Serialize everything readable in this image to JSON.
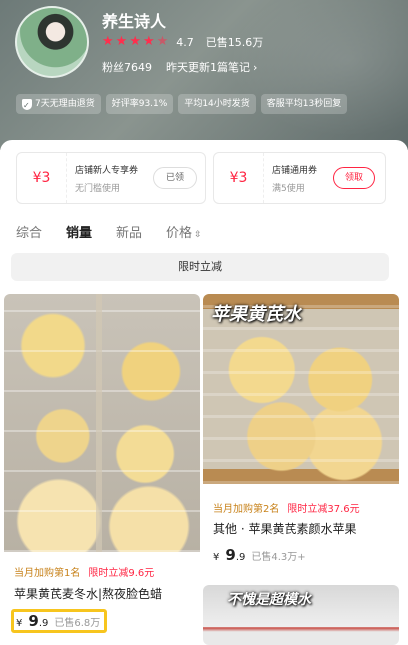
{
  "shop": {
    "name": "养生诗人",
    "rating": "4.7",
    "sold": "已售15.6万",
    "fans": "粉丝7649",
    "update": "昨天更新1篇笔记"
  },
  "tags": [
    "7天无理由退货",
    "好评率93.1%",
    "平均14小时发货",
    "客服平均13秒回复"
  ],
  "coupons": [
    {
      "amount": "¥3",
      "title": "店铺新人专享券",
      "sub": "无门槛使用",
      "button": "已领"
    },
    {
      "amount": "¥3",
      "title": "店铺通用券",
      "sub": "满5使用",
      "button": "领取"
    }
  ],
  "sort_tabs": [
    "综合",
    "销量",
    "新品",
    "价格"
  ],
  "active_sort": "销量",
  "flash_bar": "限时立减",
  "products": [
    {
      "rank_badge": "当月加购第1名",
      "cut_badge": "限时立减9.6元",
      "title": "苹果黄芪麦冬水|熬夜脸色蜡",
      "yen": "¥",
      "price_int": "9",
      "price_dec": ".9",
      "sold": "已售6.8万"
    },
    {
      "image_caption": "苹果黄芪水",
      "rank_badge": "当月加购第2名",
      "cut_badge": "限时立减37.6元",
      "title": "其他 · 苹果黄芪素颜水苹果",
      "yen": "¥",
      "price_int": "9",
      "price_dec": ".9",
      "sold": "已售4.3万+"
    },
    {
      "image_caption": "不愧是超模水"
    }
  ],
  "colors": {
    "accent": "#ff2442",
    "highlight": "#f7c51e",
    "rank": "#c8831c"
  },
  "icons": [
    "shield-check-icon",
    "star-icon",
    "chevron-right-icon",
    "sort-arrows-icon"
  ]
}
